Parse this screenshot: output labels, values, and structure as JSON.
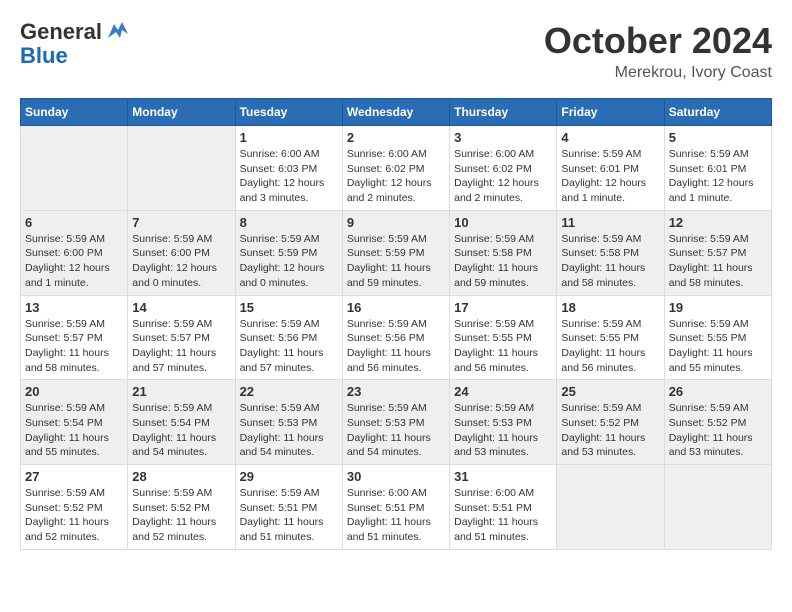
{
  "header": {
    "logo_general": "General",
    "logo_blue": "Blue",
    "month_title": "October 2024",
    "location": "Merekrou, Ivory Coast"
  },
  "calendar": {
    "days_of_week": [
      "Sunday",
      "Monday",
      "Tuesday",
      "Wednesday",
      "Thursday",
      "Friday",
      "Saturday"
    ],
    "weeks": [
      {
        "days": [
          {
            "date": "",
            "info": ""
          },
          {
            "date": "",
            "info": ""
          },
          {
            "date": "1",
            "info": "Sunrise: 6:00 AM\nSunset: 6:03 PM\nDaylight: 12 hours and 3 minutes."
          },
          {
            "date": "2",
            "info": "Sunrise: 6:00 AM\nSunset: 6:02 PM\nDaylight: 12 hours and 2 minutes."
          },
          {
            "date": "3",
            "info": "Sunrise: 6:00 AM\nSunset: 6:02 PM\nDaylight: 12 hours and 2 minutes."
          },
          {
            "date": "4",
            "info": "Sunrise: 5:59 AM\nSunset: 6:01 PM\nDaylight: 12 hours and 1 minute."
          },
          {
            "date": "5",
            "info": "Sunrise: 5:59 AM\nSunset: 6:01 PM\nDaylight: 12 hours and 1 minute."
          }
        ]
      },
      {
        "days": [
          {
            "date": "6",
            "info": "Sunrise: 5:59 AM\nSunset: 6:00 PM\nDaylight: 12 hours and 1 minute."
          },
          {
            "date": "7",
            "info": "Sunrise: 5:59 AM\nSunset: 6:00 PM\nDaylight: 12 hours and 0 minutes."
          },
          {
            "date": "8",
            "info": "Sunrise: 5:59 AM\nSunset: 5:59 PM\nDaylight: 12 hours and 0 minutes."
          },
          {
            "date": "9",
            "info": "Sunrise: 5:59 AM\nSunset: 5:59 PM\nDaylight: 11 hours and 59 minutes."
          },
          {
            "date": "10",
            "info": "Sunrise: 5:59 AM\nSunset: 5:58 PM\nDaylight: 11 hours and 59 minutes."
          },
          {
            "date": "11",
            "info": "Sunrise: 5:59 AM\nSunset: 5:58 PM\nDaylight: 11 hours and 58 minutes."
          },
          {
            "date": "12",
            "info": "Sunrise: 5:59 AM\nSunset: 5:57 PM\nDaylight: 11 hours and 58 minutes."
          }
        ]
      },
      {
        "days": [
          {
            "date": "13",
            "info": "Sunrise: 5:59 AM\nSunset: 5:57 PM\nDaylight: 11 hours and 58 minutes."
          },
          {
            "date": "14",
            "info": "Sunrise: 5:59 AM\nSunset: 5:57 PM\nDaylight: 11 hours and 57 minutes."
          },
          {
            "date": "15",
            "info": "Sunrise: 5:59 AM\nSunset: 5:56 PM\nDaylight: 11 hours and 57 minutes."
          },
          {
            "date": "16",
            "info": "Sunrise: 5:59 AM\nSunset: 5:56 PM\nDaylight: 11 hours and 56 minutes."
          },
          {
            "date": "17",
            "info": "Sunrise: 5:59 AM\nSunset: 5:55 PM\nDaylight: 11 hours and 56 minutes."
          },
          {
            "date": "18",
            "info": "Sunrise: 5:59 AM\nSunset: 5:55 PM\nDaylight: 11 hours and 56 minutes."
          },
          {
            "date": "19",
            "info": "Sunrise: 5:59 AM\nSunset: 5:55 PM\nDaylight: 11 hours and 55 minutes."
          }
        ]
      },
      {
        "days": [
          {
            "date": "20",
            "info": "Sunrise: 5:59 AM\nSunset: 5:54 PM\nDaylight: 11 hours and 55 minutes."
          },
          {
            "date": "21",
            "info": "Sunrise: 5:59 AM\nSunset: 5:54 PM\nDaylight: 11 hours and 54 minutes."
          },
          {
            "date": "22",
            "info": "Sunrise: 5:59 AM\nSunset: 5:53 PM\nDaylight: 11 hours and 54 minutes."
          },
          {
            "date": "23",
            "info": "Sunrise: 5:59 AM\nSunset: 5:53 PM\nDaylight: 11 hours and 54 minutes."
          },
          {
            "date": "24",
            "info": "Sunrise: 5:59 AM\nSunset: 5:53 PM\nDaylight: 11 hours and 53 minutes."
          },
          {
            "date": "25",
            "info": "Sunrise: 5:59 AM\nSunset: 5:52 PM\nDaylight: 11 hours and 53 minutes."
          },
          {
            "date": "26",
            "info": "Sunrise: 5:59 AM\nSunset: 5:52 PM\nDaylight: 11 hours and 53 minutes."
          }
        ]
      },
      {
        "days": [
          {
            "date": "27",
            "info": "Sunrise: 5:59 AM\nSunset: 5:52 PM\nDaylight: 11 hours and 52 minutes."
          },
          {
            "date": "28",
            "info": "Sunrise: 5:59 AM\nSunset: 5:52 PM\nDaylight: 11 hours and 52 minutes."
          },
          {
            "date": "29",
            "info": "Sunrise: 5:59 AM\nSunset: 5:51 PM\nDaylight: 11 hours and 51 minutes."
          },
          {
            "date": "30",
            "info": "Sunrise: 6:00 AM\nSunset: 5:51 PM\nDaylight: 11 hours and 51 minutes."
          },
          {
            "date": "31",
            "info": "Sunrise: 6:00 AM\nSunset: 5:51 PM\nDaylight: 11 hours and 51 minutes."
          },
          {
            "date": "",
            "info": ""
          },
          {
            "date": "",
            "info": ""
          }
        ]
      }
    ]
  }
}
